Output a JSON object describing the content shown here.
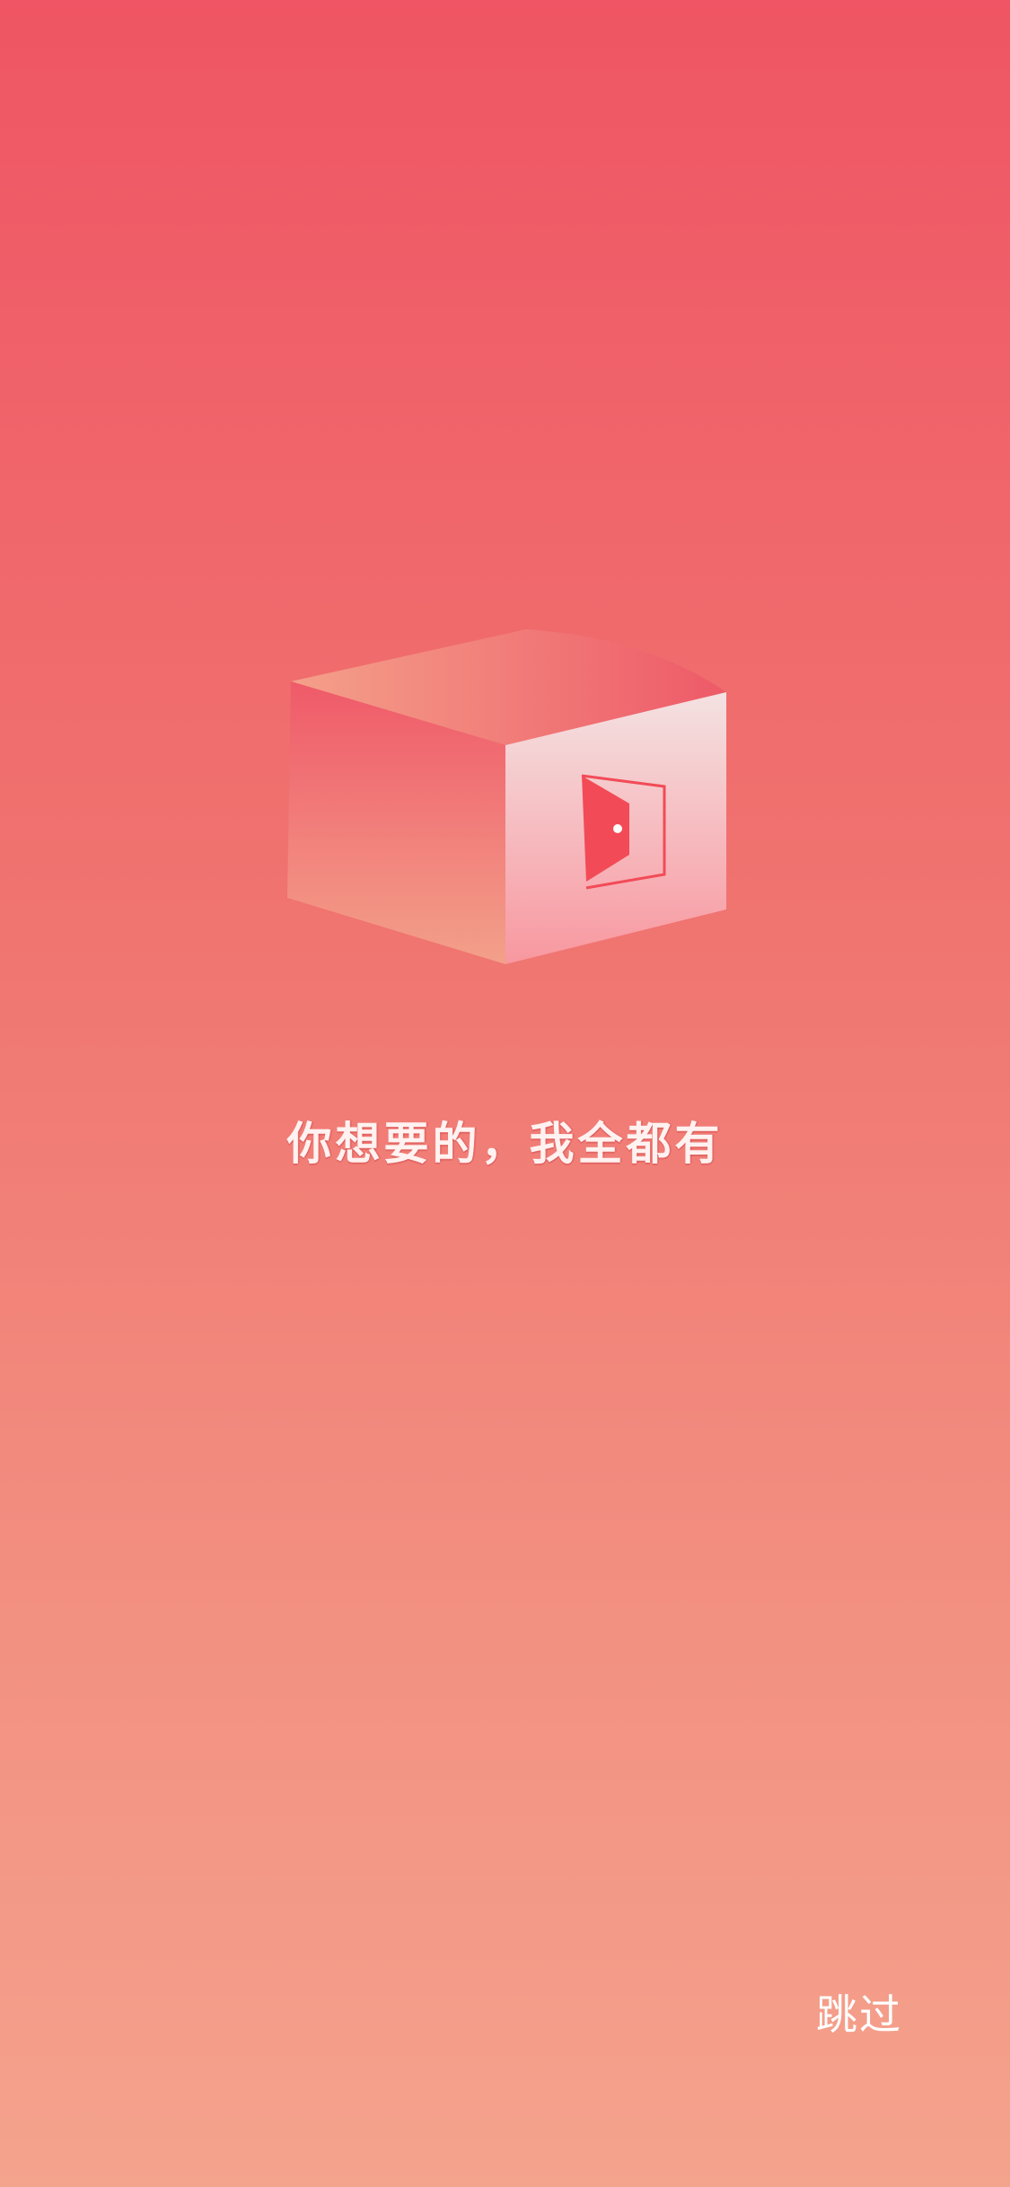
{
  "screen": "splash",
  "logo": {
    "icon": "cube-with-door-icon",
    "colors": {
      "cube_top_left": "#F4A08A",
      "cube_top_right": "#EE5A68",
      "cube_left_top": "#EF5A69",
      "cube_left_bottom": "#F3A08A",
      "cube_right_top": "#F4E2E2",
      "cube_right_bottom": "#F8979F",
      "door": "#F24B57"
    }
  },
  "slogan": "你想要的，我全都有",
  "skip_label": "跳过",
  "colors": {
    "background_top": "#EF5564",
    "background_bottom": "#F4A38D",
    "text": "#FFFFFF"
  }
}
